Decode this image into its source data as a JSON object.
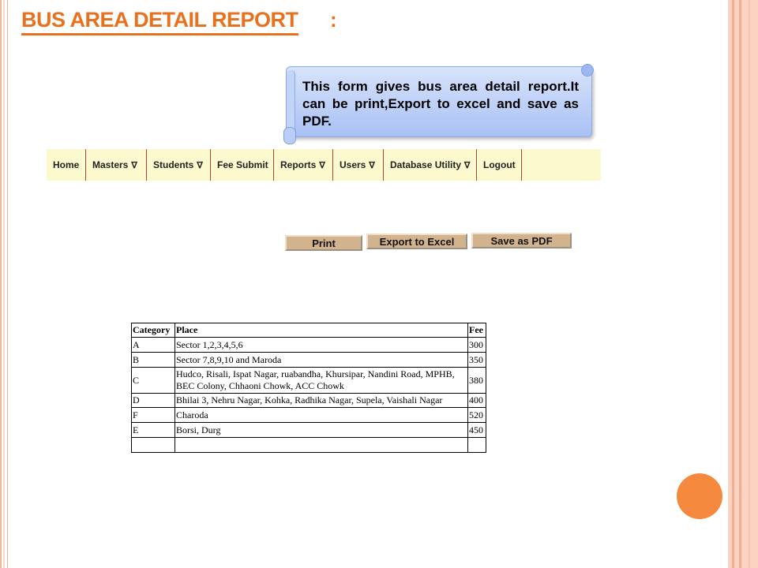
{
  "title": "Bus area detail Report",
  "title_suffix": ":",
  "callout_text": "This form gives bus area detail report.It can be print,Export to excel and save as PDF.",
  "nav": [
    {
      "label": "Home",
      "arrow": ""
    },
    {
      "label": "Masters",
      "arrow": "∇"
    },
    {
      "label": "Students",
      "arrow": "∇"
    },
    {
      "label": "Fee Submit",
      "arrow": ""
    },
    {
      "label": "Reports",
      "arrow": "∇"
    },
    {
      "label": "Users",
      "arrow": "∇"
    },
    {
      "label": "Database Utility",
      "arrow": "∇"
    },
    {
      "label": "Logout",
      "arrow": ""
    }
  ],
  "buttons": {
    "print": "Print",
    "export": "Export to Excel",
    "pdf": "Save as PDF"
  },
  "table": {
    "headers": [
      "Category",
      "Place",
      "Fee"
    ],
    "rows": [
      [
        "A",
        "Sector 1,2,3,4,5,6",
        "300"
      ],
      [
        "B",
        "Sector 7,8,9,10 and Maroda",
        "350"
      ],
      [
        "C",
        "Hudco, Risali, Ispat Nagar, ruabandha, Khursipar, Nandini Road, MPHB, BEC Colony, Chhaoni Chowk, ACC Chowk",
        "380"
      ],
      [
        "D",
        "Bhilai 3, Nehru Nagar, Kohka, Radhika Nagar, Supela, Vaishali Nagar",
        "400"
      ],
      [
        "F",
        "Charoda",
        "520"
      ],
      [
        "E",
        "Borsi, Durg",
        "450"
      ],
      [
        "",
        "",
        ""
      ]
    ]
  },
  "colors": {
    "title": "#e8711e",
    "nav_bg": "#fbf9cd",
    "button_bg": "#d2b38e",
    "callout_bg": "#a9c1f4",
    "accent_circle": "#f58a3e"
  }
}
